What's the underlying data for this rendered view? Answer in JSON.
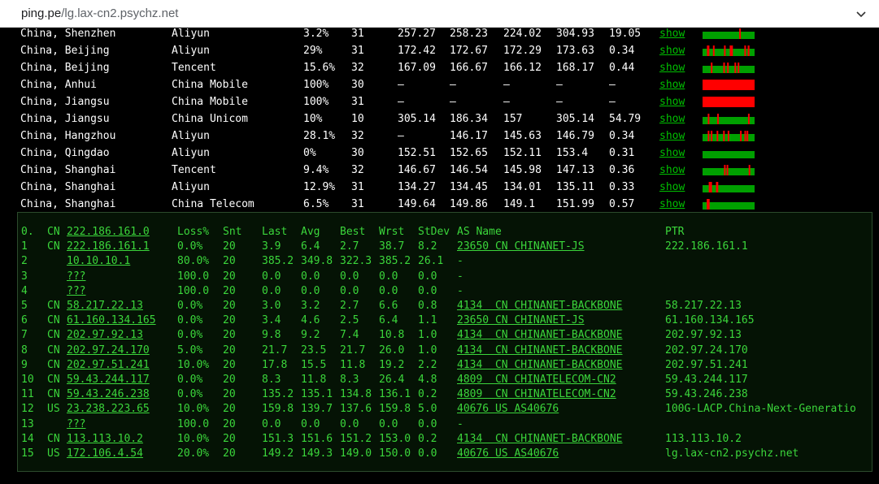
{
  "browser": {
    "url_host": "ping.pe",
    "url_path": "/lg.lax-cn2.psychz.net"
  },
  "colors": {
    "ok": "#00a000",
    "loss": "#ff0000",
    "text_green": "#3bd63b",
    "link_green": "#00c000"
  },
  "nodes": [
    {
      "location": "China, Shenzhen",
      "isp": "Aliyun",
      "loss": "3.2%",
      "sent": "31",
      "last": "257.27",
      "avg": "258.23",
      "best": "224.02",
      "worst": "304.93",
      "stdev": "19.05",
      "action": "show",
      "loss_frac": 0.032
    },
    {
      "location": "China, Beijing",
      "isp": "Aliyun",
      "loss": "29%",
      "sent": "31",
      "last": "172.42",
      "avg": "172.67",
      "best": "172.29",
      "worst": "173.63",
      "stdev": "0.34",
      "action": "show",
      "loss_frac": 0.29
    },
    {
      "location": "China, Beijing",
      "isp": "Tencent",
      "loss": "15.6%",
      "sent": "32",
      "last": "167.09",
      "avg": "166.67",
      "best": "166.12",
      "worst": "168.17",
      "stdev": "0.44",
      "action": "show",
      "loss_frac": 0.156
    },
    {
      "location": "China, Anhui",
      "isp": "China Mobile",
      "loss": "100%",
      "sent": "30",
      "last": "–",
      "avg": "–",
      "best": "–",
      "worst": "–",
      "stdev": "–",
      "action": "show",
      "loss_frac": 1.0
    },
    {
      "location": "China, Jiangsu",
      "isp": "China Mobile",
      "loss": "100%",
      "sent": "31",
      "last": "–",
      "avg": "–",
      "best": "–",
      "worst": "–",
      "stdev": "–",
      "action": "show",
      "loss_frac": 1.0
    },
    {
      "location": "China, Jiangsu",
      "isp": "China Unicom",
      "loss": "10%",
      "sent": "10",
      "last": "305.14",
      "avg": "186.34",
      "best": "157",
      "worst": "305.14",
      "stdev": "54.79",
      "action": "show",
      "loss_frac": 0.1
    },
    {
      "location": "China, Hangzhou",
      "isp": "Aliyun",
      "loss": "28.1%",
      "sent": "32",
      "last": "–",
      "avg": "146.17",
      "best": "145.63",
      "worst": "146.79",
      "stdev": "0.34",
      "action": "show",
      "loss_frac": 0.281
    },
    {
      "location": "China, Qingdao",
      "isp": "Aliyun",
      "loss": "0%",
      "sent": "30",
      "last": "152.51",
      "avg": "152.65",
      "best": "152.11",
      "worst": "153.4",
      "stdev": "0.31",
      "action": "show",
      "loss_frac": 0.0
    },
    {
      "location": "China, Shanghai",
      "isp": "Tencent",
      "loss": "9.4%",
      "sent": "32",
      "last": "146.67",
      "avg": "146.54",
      "best": "145.98",
      "worst": "147.13",
      "stdev": "0.36",
      "action": "show",
      "loss_frac": 0.094
    },
    {
      "location": "China, Shanghai",
      "isp": "Aliyun",
      "loss": "12.9%",
      "sent": "31",
      "last": "134.27",
      "avg": "134.45",
      "best": "134.01",
      "worst": "135.11",
      "stdev": "0.33",
      "action": "show",
      "loss_frac": 0.129
    },
    {
      "location": "China, Shanghai",
      "isp": "China Telecom",
      "loss": "6.5%",
      "sent": "31",
      "last": "149.64",
      "avg": "149.86",
      "best": "149.1",
      "worst": "151.99",
      "stdev": "0.57",
      "action": "show",
      "loss_frac": 0.065
    }
  ],
  "mtr": {
    "header": {
      "hop": "0.",
      "cc": "CN",
      "host": "222.186.161.0",
      "loss": "Loss%",
      "snt": "Snt",
      "last": "Last",
      "avg": "Avg",
      "best": "Best",
      "wrst": "Wrst",
      "stdev": "StDev",
      "as": "AS Name",
      "ptr": "PTR"
    },
    "rows": [
      {
        "hop": "1",
        "cc": "CN",
        "host": "222.186.161.1",
        "loss": "0.0%",
        "snt": "20",
        "last": "3.9",
        "avg": "6.4",
        "best": "2.7",
        "wrst": "38.7",
        "stdev": "8.2",
        "as": "23650 CN CHINANET-JS",
        "ptr": "222.186.161.1"
      },
      {
        "hop": "2",
        "cc": "",
        "host": "10.10.10.1",
        "loss": "80.0%",
        "snt": "20",
        "last": "385.2",
        "avg": "349.8",
        "best": "322.3",
        "wrst": "385.2",
        "stdev": "26.1",
        "as": "-",
        "ptr": ""
      },
      {
        "hop": "3",
        "cc": "",
        "host": "???",
        "loss": "100.0",
        "snt": "20",
        "last": "0.0",
        "avg": "0.0",
        "best": "0.0",
        "wrst": "0.0",
        "stdev": "0.0",
        "as": "-",
        "ptr": ""
      },
      {
        "hop": "4",
        "cc": "",
        "host": "???",
        "loss": "100.0",
        "snt": "20",
        "last": "0.0",
        "avg": "0.0",
        "best": "0.0",
        "wrst": "0.0",
        "stdev": "0.0",
        "as": "-",
        "ptr": ""
      },
      {
        "hop": "5",
        "cc": "CN",
        "host": "58.217.22.13",
        "loss": "0.0%",
        "snt": "20",
        "last": "3.0",
        "avg": "3.2",
        "best": "2.7",
        "wrst": "6.6",
        "stdev": "0.8",
        "as": "4134  CN CHINANET-BACKBONE",
        "ptr": "58.217.22.13"
      },
      {
        "hop": "6",
        "cc": "CN",
        "host": "61.160.134.165",
        "loss": "0.0%",
        "snt": "20",
        "last": "3.4",
        "avg": "4.6",
        "best": "2.5",
        "wrst": "6.4",
        "stdev": "1.1",
        "as": "23650 CN CHINANET-JS",
        "ptr": "61.160.134.165"
      },
      {
        "hop": "7",
        "cc": "CN",
        "host": "202.97.92.13",
        "loss": "0.0%",
        "snt": "20",
        "last": "9.8",
        "avg": "9.2",
        "best": "7.4",
        "wrst": "10.8",
        "stdev": "1.0",
        "as": "4134  CN CHINANET-BACKBONE",
        "ptr": "202.97.92.13"
      },
      {
        "hop": "8",
        "cc": "CN",
        "host": "202.97.24.170",
        "loss": "5.0%",
        "snt": "20",
        "last": "21.7",
        "avg": "23.5",
        "best": "21.7",
        "wrst": "26.0",
        "stdev": "1.0",
        "as": "4134  CN CHINANET-BACKBONE",
        "ptr": "202.97.24.170"
      },
      {
        "hop": "9",
        "cc": "CN",
        "host": "202.97.51.241",
        "loss": "10.0%",
        "snt": "20",
        "last": "17.8",
        "avg": "15.5",
        "best": "11.8",
        "wrst": "19.2",
        "stdev": "2.2",
        "as": "4134  CN CHINANET-BACKBONE",
        "ptr": "202.97.51.241"
      },
      {
        "hop": "10",
        "cc": "CN",
        "host": "59.43.244.117",
        "loss": "0.0%",
        "snt": "20",
        "last": "8.3",
        "avg": "11.8",
        "best": "8.3",
        "wrst": "26.4",
        "stdev": "4.8",
        "as": "4809  CN CHINATELECOM-CN2",
        "ptr": "59.43.244.117"
      },
      {
        "hop": "11",
        "cc": "CN",
        "host": "59.43.246.238",
        "loss": "0.0%",
        "snt": "20",
        "last": "135.2",
        "avg": "135.1",
        "best": "134.8",
        "wrst": "136.1",
        "stdev": "0.2",
        "as": "4809  CN CHINATELECOM-CN2",
        "ptr": "59.43.246.238"
      },
      {
        "hop": "12",
        "cc": "US",
        "host": "23.238.223.65",
        "loss": "10.0%",
        "snt": "20",
        "last": "159.8",
        "avg": "139.7",
        "best": "137.6",
        "wrst": "159.8",
        "stdev": "5.0",
        "as": "40676 US AS40676",
        "ptr": "100G-LACP.China-Next-Generatio"
      },
      {
        "hop": "13",
        "cc": "",
        "host": "???",
        "loss": "100.0",
        "snt": "20",
        "last": "0.0",
        "avg": "0.0",
        "best": "0.0",
        "wrst": "0.0",
        "stdev": "0.0",
        "as": "-",
        "ptr": ""
      },
      {
        "hop": "14",
        "cc": "CN",
        "host": "113.113.10.2",
        "loss": "10.0%",
        "snt": "20",
        "last": "151.3",
        "avg": "151.6",
        "best": "151.2",
        "wrst": "153.0",
        "stdev": "0.2",
        "as": "4134  CN CHINANET-BACKBONE",
        "ptr": "113.113.10.2"
      },
      {
        "hop": "15",
        "cc": "US",
        "host": "172.106.4.54",
        "loss": "20.0%",
        "snt": "20",
        "last": "149.2",
        "avg": "149.3",
        "best": "149.0",
        "wrst": "150.0",
        "stdev": "0.0",
        "as": "40676 US AS40676",
        "ptr": "lg.lax-cn2.psychz.net"
      }
    ]
  }
}
